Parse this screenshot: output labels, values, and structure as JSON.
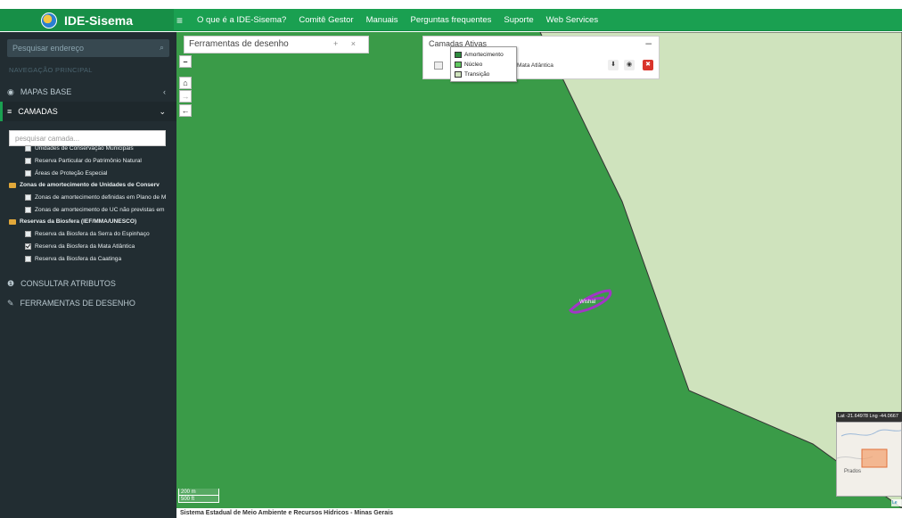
{
  "app": {
    "title": "IDE-Sisema"
  },
  "menu": {
    "items": [
      "O que é a IDE-Sisema?",
      "Comitê Gestor",
      "Manuais",
      "Perguntas frequentes",
      "Suporte",
      "Web Services"
    ]
  },
  "sidebar": {
    "search_placeholder": "Pesquisar endereço",
    "nav_header": "NAVEGAÇÃO PRINCIPAL",
    "items": {
      "mapas_base": "MAPAS BASE",
      "camadas": "CAMADAS",
      "consultar": "CONSULTAR ATRIBUTOS",
      "ferramentas": "FERRAMENTAS DE DESENHO"
    },
    "layer_search_placeholder": "pesquisar camada...",
    "layers": [
      {
        "label": "Unidades de Conservação Municipais",
        "kind": "layer",
        "checked": false
      },
      {
        "label": "Reserva Particular do Patrimônio Natural",
        "kind": "layer",
        "checked": false
      },
      {
        "label": "Áreas de Proteção Especial",
        "kind": "layer",
        "checked": false
      },
      {
        "label": "Zonas de amortecimento de Unidades de Conserv",
        "kind": "group",
        "checked": false
      },
      {
        "label": "Zonas de amortecimento definidas em Plano de M",
        "kind": "layer",
        "checked": false
      },
      {
        "label": "Zonas de amortecimento de UC não previstas em",
        "kind": "layer",
        "checked": false
      },
      {
        "label": "Reservas da Biosfera (IEF/MMA/UNESCO)",
        "kind": "group",
        "checked": false
      },
      {
        "label": "Reserva da Biosfera da Serra do Espinhaço",
        "kind": "layer",
        "checked": false
      },
      {
        "label": "Reserva da Biosfera da Mata Atlântica",
        "kind": "layer",
        "checked": true
      },
      {
        "label": "Reserva da Biosfera da Caatinga",
        "kind": "layer",
        "checked": false
      }
    ]
  },
  "draw_panel": {
    "title": "Ferramentas de desenho",
    "actions": "+ ×"
  },
  "active_layers": {
    "title": "Camadas Ativas",
    "layer_name": "Mata Atlântica",
    "minimize": "–"
  },
  "legend": {
    "items": [
      {
        "label": "Amortecimento",
        "color": "#2e8b3e"
      },
      {
        "label": "Núcleo",
        "color": "#5fc85f"
      },
      {
        "label": "Transição",
        "color": "#cfe3bd"
      }
    ]
  },
  "map": {
    "zoom_out": "–",
    "home": "⌂",
    "forward": "→",
    "back": "←",
    "feature_label": "Wishal",
    "colors": {
      "main": "#3a9b48",
      "transition": "#cfe3bd",
      "feature": "#a236c6"
    },
    "scale": {
      "metric": "200 m",
      "imperial": "500 ft"
    },
    "coords": "Lat -21.64978 Lng -44.0667",
    "minimap_label": "Prados",
    "attribution": "Le"
  },
  "footer": {
    "text": "Sistema Estadual de Meio Ambiente e Recursos Hídricos - Minas Gerais"
  }
}
